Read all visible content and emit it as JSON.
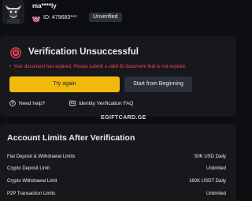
{
  "header": {
    "username": "ma****ly",
    "uid": "ID: 479683***",
    "status_badge": "Unverified"
  },
  "verification": {
    "title": "Verification Unsuccessful",
    "error_message": "Your document has expired. Please submit a valid ID document that is not expired.",
    "try_again_label": "Try again",
    "start_label": "Start from Beginning",
    "help_label": "Need help?",
    "faq_label": "Identity Verification FAQ"
  },
  "watermark": "EGIFTCARD.GE",
  "limits": {
    "title": "Account Limits After Verification",
    "rows": [
      {
        "label": "Fiat Deposit & Withdrawal Limits",
        "value": "50K USD Daily"
      },
      {
        "label": "Crypto Deposit Limit",
        "value": "Unlimited"
      },
      {
        "label": "Crypto Withdrawal Limit",
        "value": "160K USDT Daily"
      },
      {
        "label": "P2P Transaction Limits",
        "value": "Unlimited"
      }
    ]
  },
  "colors": {
    "accent": "#f0b90b",
    "error": "#f6465d",
    "background": "#0c0e11",
    "card": "#16181c"
  },
  "icons": [
    "bull-avatar-icon",
    "uk-flag-icon",
    "error-x-icon",
    "help-circle-icon",
    "id-card-icon"
  ]
}
